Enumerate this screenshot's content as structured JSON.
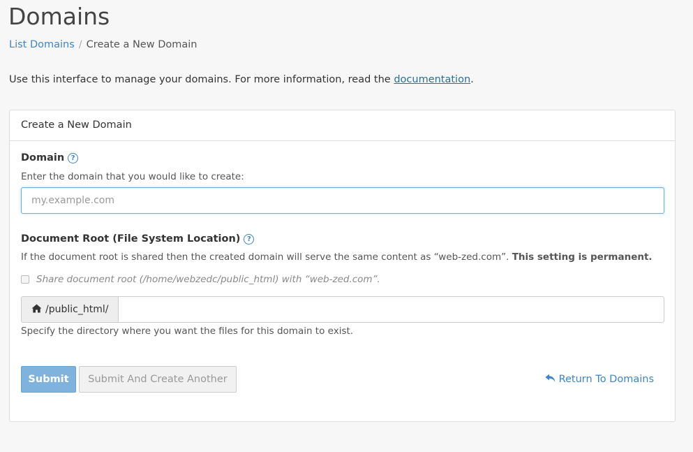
{
  "page_title": "Domains",
  "breadcrumb": {
    "link": "List Domains",
    "separator": "/",
    "current": "Create a New Domain"
  },
  "intro": {
    "text": "Use this interface to manage your domains. For more information, read the ",
    "link": "documentation",
    "end": "."
  },
  "panel": {
    "heading": "Create a New Domain",
    "domain": {
      "label": "Domain",
      "help_icon": "?",
      "helptext": "Enter the domain that you would like to create:",
      "placeholder": "my.example.com",
      "value": ""
    },
    "docroot": {
      "label": "Document Root (File System Location)",
      "help_icon": "?",
      "helptext": "If the document root is shared then the created domain will serve the same content as “web-zed.com”. ",
      "helptext_bold": "This setting is permanent.",
      "share_checkbox_label": "Share document root (/home/webzedc/public_html) with “web-zed.com”.",
      "share_checked": false,
      "prefix": "/public_html/",
      "prefix_icon": "home-icon",
      "value": "",
      "footer_help": "Specify the directory where you want the files for this domain to exist."
    },
    "buttons": {
      "submit": "Submit",
      "submit_another": "Submit And Create Another",
      "return_link": "Return To Domains",
      "return_icon": "reply-arrow-icon"
    }
  },
  "colors": {
    "link": "#3d85c6",
    "primary_button": "#7fb3de",
    "input_focus_border": "#66afe9"
  }
}
